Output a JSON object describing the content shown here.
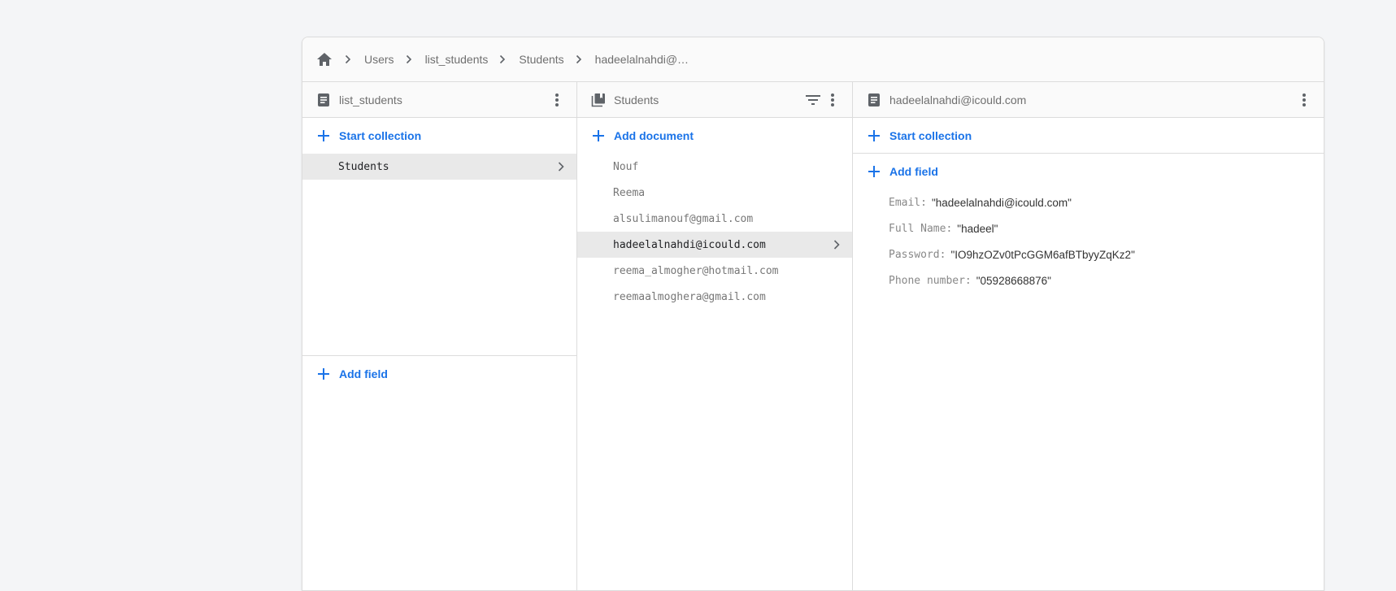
{
  "breadcrumb": {
    "home_icon": "home-icon",
    "items": [
      "Users",
      "list_students",
      "Students",
      "hadeelalnahdi@…"
    ]
  },
  "columns": {
    "collection_root": {
      "title": "list_students",
      "icon": "document-icon",
      "start_collection_label": "Start collection",
      "items": [
        {
          "label": "Students",
          "selected": true
        }
      ],
      "add_field_label": "Add field"
    },
    "collection": {
      "title": "Students",
      "icon": "collection-icon",
      "add_document_label": "Add document",
      "items": [
        {
          "label": "Nouf",
          "selected": false
        },
        {
          "label": "Reema",
          "selected": false
        },
        {
          "label": "alsulimanouf@gmail.com",
          "selected": false
        },
        {
          "label": "hadeelalnahdi@icould.com",
          "selected": true
        },
        {
          "label": "reema_almogher@hotmail.com",
          "selected": false
        },
        {
          "label": "reemaalmoghera@gmail.com",
          "selected": false
        }
      ]
    },
    "document": {
      "title": "hadeelalnahdi@icould.com",
      "icon": "document-icon",
      "start_collection_label": "Start collection",
      "add_field_label": "Add field",
      "fields": [
        {
          "key": "Email:",
          "value": "\"hadeelalnahdi@icould.com\""
        },
        {
          "key": "Full Name:",
          "value": "\"hadeel\""
        },
        {
          "key": "Password:",
          "value": "\"IO9hzOZv0tPcGGM6afBTbyyZqKz2\""
        },
        {
          "key": "Phone number:",
          "value": "\"05928668876\""
        }
      ]
    }
  },
  "colors": {
    "accent": "#1a73e8",
    "selected_row": "#e9e9e9",
    "header_bg": "#fafafa"
  }
}
